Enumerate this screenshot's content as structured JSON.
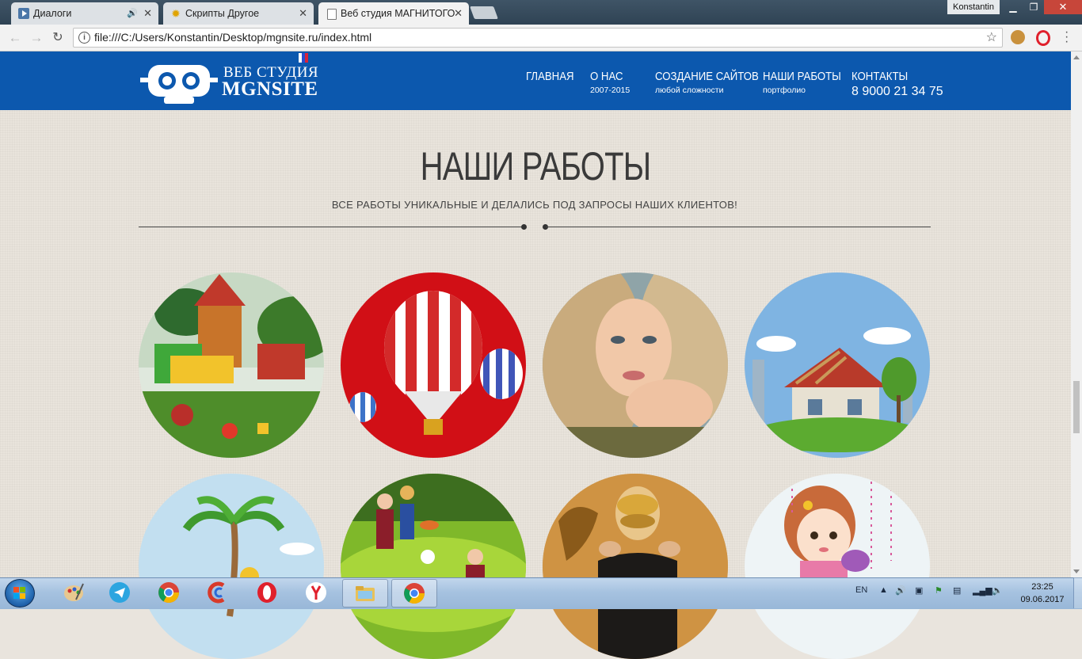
{
  "browser": {
    "tabs": [
      {
        "title": "Диалоги",
        "icon": "vk-dialogs-icon",
        "has_audio": true
      },
      {
        "title": "Скрипты Другое",
        "icon": "sun-icon"
      },
      {
        "title": "Веб студия МАГНИТОГО",
        "icon": "page-icon",
        "active": true
      }
    ],
    "user": "Konstantin",
    "url": "file:///C:/Users/Konstantin/Desktop/mgnsite.ru/index.html",
    "window_controls": {
      "minimize": "▁",
      "restore": "❐",
      "close": "✕"
    }
  },
  "site": {
    "logo": {
      "line1": "ВЕБ СТУДИЯ",
      "line2": "MGNSITE"
    },
    "nav": [
      {
        "label": "ГЛАВНАЯ",
        "sub": ""
      },
      {
        "label": "О НАС",
        "sub": "2007-2015"
      },
      {
        "label": "СОЗДАНИЕ САЙТОВ",
        "sub": "любой сложности"
      },
      {
        "label": "НАШИ РАБОТЫ",
        "sub": "портфолио"
      },
      {
        "label": "КОНТАКТЫ",
        "sub": "8 9000 21 34 75"
      }
    ],
    "colors": {
      "header": "#0c58ae",
      "text": "#3a3a3a"
    },
    "works": {
      "title": "НАШИ РАБОТЫ",
      "subtitle": "ВСЕ РАБОТЫ УНИКАЛЬНЫЕ И ДЕЛАЛИСЬ ПОД ЗАПРОСЫ НАШИХ КЛИЕНТОВ!",
      "items": [
        {
          "subject": "playground"
        },
        {
          "subject": "hot-air-balloons"
        },
        {
          "subject": "woman-portrait"
        },
        {
          "subject": "house-construction"
        },
        {
          "subject": "palm-beach"
        },
        {
          "subject": "school-children"
        },
        {
          "subject": "masquerade-woman"
        },
        {
          "subject": "cartoon-girl"
        }
      ]
    }
  },
  "taskbar": {
    "apps": [
      "paint-icon",
      "telegram-icon",
      "chrome-icon",
      "ccleaner-icon",
      "opera-icon",
      "yandex-icon",
      "explorer-icon",
      "chrome-active-icon"
    ],
    "lang": "EN",
    "time": "23:25",
    "date": "09.06.2017"
  }
}
